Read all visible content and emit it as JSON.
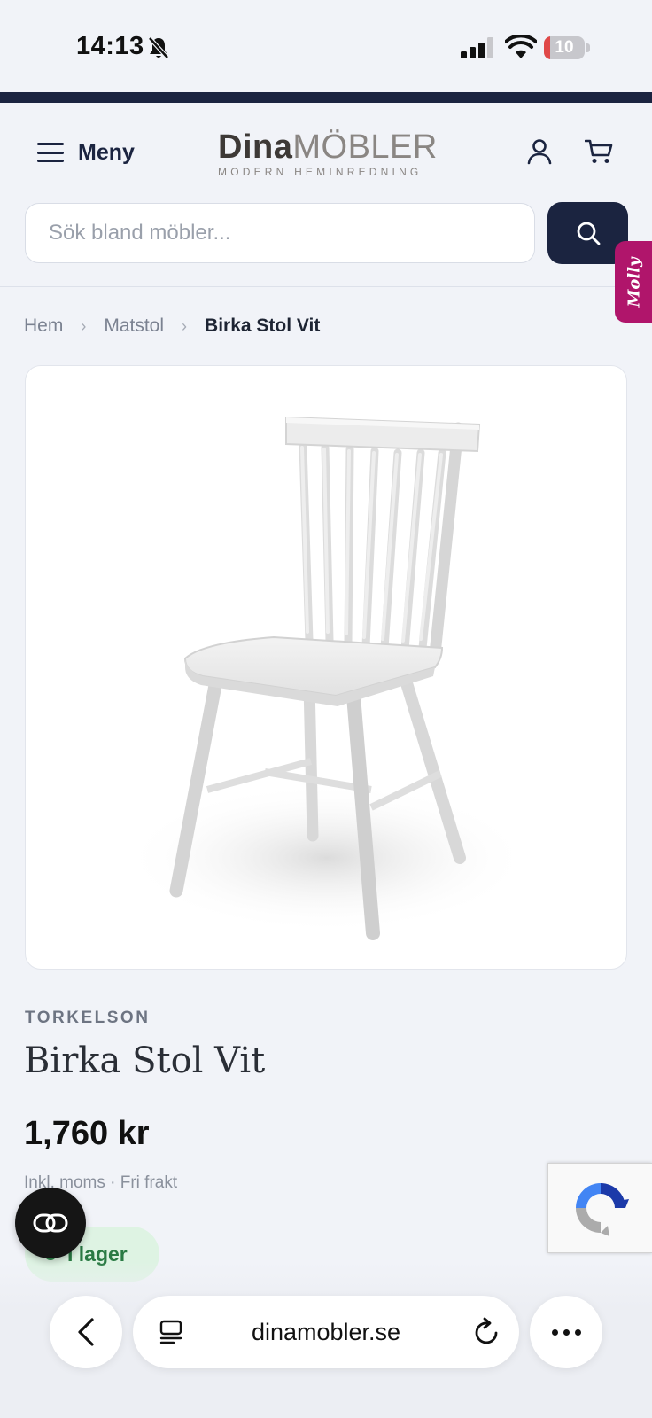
{
  "status_bar": {
    "time": "14:13",
    "battery_level": "10",
    "battery_fraction": 0.1,
    "icons": [
      "bell-slash-icon",
      "cellular-signal-icon",
      "wifi-icon",
      "battery-icon"
    ]
  },
  "header": {
    "menu_label": "Meny",
    "logo": {
      "primary": "Dina",
      "secondary": "MÖBLER",
      "tagline": "MODERN HEMINREDNING"
    },
    "icons": [
      "hamburger-icon",
      "user-icon",
      "cart-icon"
    ]
  },
  "search": {
    "placeholder": "Sök bland möbler...",
    "value": "",
    "button_icon": "search-icon"
  },
  "side_tab": {
    "label": "Molly",
    "color": "#b0156b"
  },
  "breadcrumb": {
    "items": [
      "Hem",
      "Matstol"
    ],
    "current": "Birka Stol Vit",
    "separator": "›"
  },
  "product": {
    "image_subject": "white spindle-back wooden dining chair",
    "brand": "TORKELSON",
    "title": "Birka Stol Vit",
    "price": "1,760 kr",
    "price_note": "Inkl. moms · Fri frakt",
    "stock": "I lager",
    "stock_color": "#2e8b4c"
  },
  "floating": {
    "chat_icon": "chat-link-icon",
    "recaptcha_icon": "recaptcha-icon"
  },
  "browser": {
    "url": "dinamobler.se",
    "icons": [
      "back-chevron-icon",
      "tab-overview-icon",
      "reload-icon",
      "more-dots-icon"
    ]
  },
  "colors": {
    "brand_navy": "#1b2440",
    "background": "#f1f3f8"
  }
}
